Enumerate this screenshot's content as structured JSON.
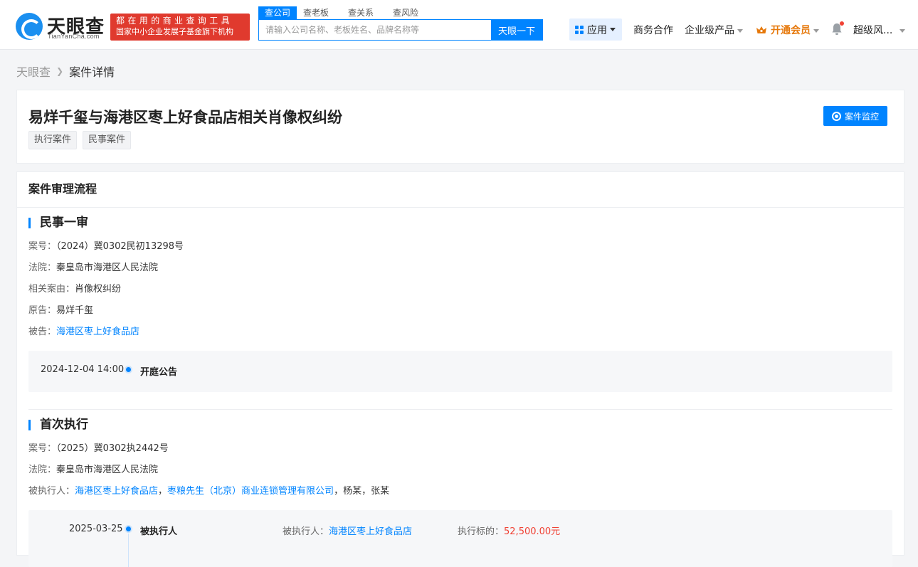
{
  "header": {
    "logo_text": "天眼查",
    "logo_sub": "TianYanCha.com",
    "slogan_line1": "都在用的商业查询工具",
    "slogan_line2": "国家中小企业发展子基金旗下机构",
    "search_tabs": [
      "查公司",
      "查老板",
      "查关系",
      "查风险"
    ],
    "search_placeholder": "请输入公司名称、老板姓名、品牌名称等",
    "search_button": "天眼一下",
    "nav_apps": "应用",
    "nav_business": "商务合作",
    "nav_enterprise": "企业级产品",
    "nav_vip": "开通会员",
    "nav_user": "超级风..."
  },
  "breadcrumb": {
    "home": "天眼查",
    "current": "案件详情"
  },
  "case": {
    "title": "易烊千玺与海港区枣上好食品店相关肖像权纠纷",
    "tags": [
      "执行案件",
      "民事案件"
    ],
    "monitor_button": "案件监控"
  },
  "flow": {
    "header": "案件审理流程",
    "stages": [
      {
        "title": "民事一审",
        "fields": [
          {
            "k": "案号：",
            "v": "（2024）冀0302民初13298号"
          },
          {
            "k": "法院：",
            "v": "秦皇岛市海港区人民法院"
          },
          {
            "k": "相关案由：",
            "v": "肖像权纠纷"
          },
          {
            "k": "原告：",
            "v": "易烊千玺"
          },
          {
            "k": "被告：",
            "v": "海港区枣上好食品店"
          }
        ],
        "timeline": [
          {
            "date": "2024-12-04 14:00",
            "type": "开庭公告"
          }
        ]
      },
      {
        "title": "首次执行",
        "fields": [
          {
            "k": "案号：",
            "v": "（2025）冀0302执2442号"
          },
          {
            "k": "法院：",
            "v": "秦皇岛市海港区人民法院"
          },
          {
            "k": "被执行人：",
            "v1": "海港区枣上好食品店",
            "sep1": "，",
            "v2": "枣粮先生（北京）商业连锁管理有限公司",
            "v3": "，杨某，张某"
          }
        ],
        "timeline": [
          {
            "date": "2025-03-25",
            "type": "被执行人",
            "k1": "被执行人：",
            "v1": "海港区枣上好食品店",
            "k2": "执行标的：",
            "v2": "52,500.00元"
          }
        ]
      }
    ]
  },
  "colors": {
    "accent": "#0084ff",
    "slogan_bg": "#e03a2e",
    "vip": "#e6790c",
    "money": "#f04134"
  }
}
